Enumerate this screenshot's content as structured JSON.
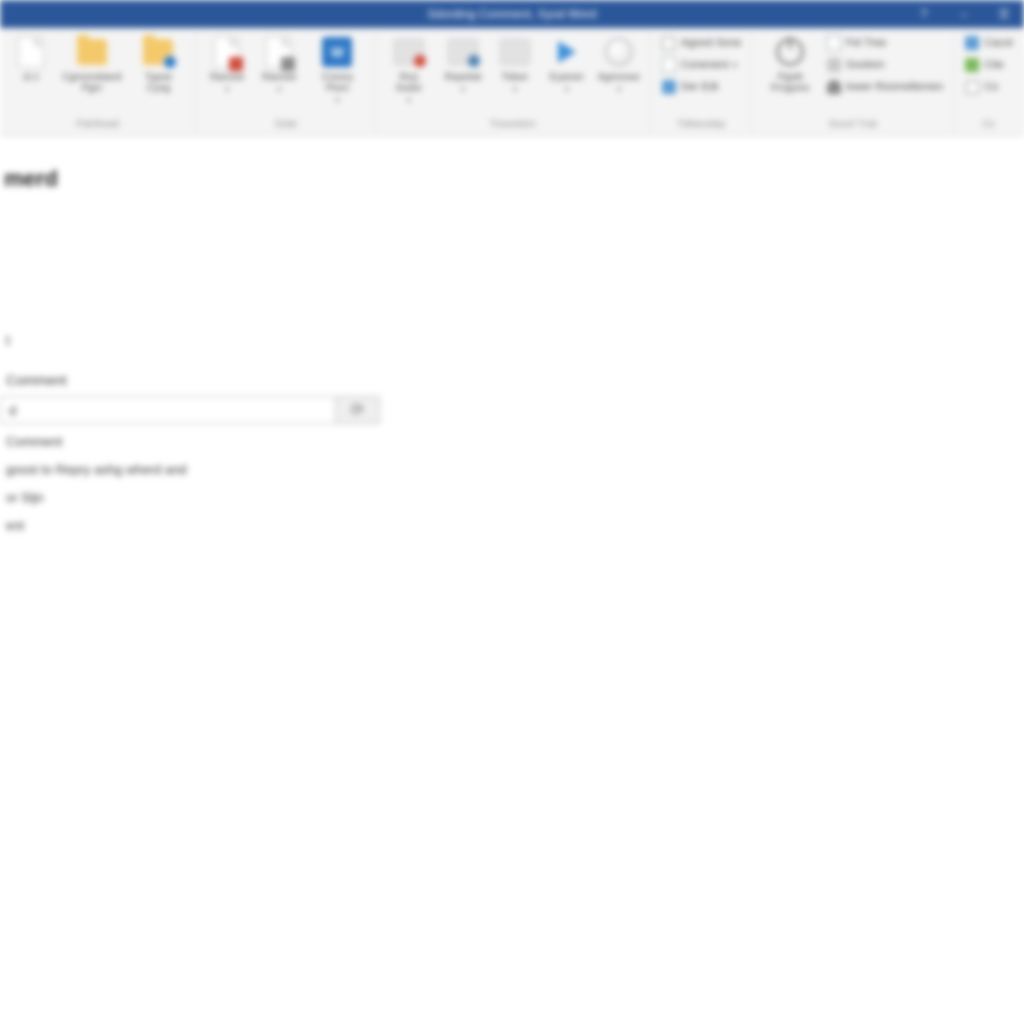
{
  "titlebar": {
    "title": "Sdording Comment, Xyod Word",
    "help": "?",
    "minimize": "–",
    "menu": "☰"
  },
  "ribbon": {
    "groups": [
      {
        "label": "Pairthead",
        "buttons": [
          {
            "label": "st\n n",
            "icon": "page"
          },
          {
            "label": "Cgmonsband\nPgm",
            "icon": "folder"
          },
          {
            "label": "Typoe\nCyog",
            "icon": "folder-badge"
          }
        ]
      },
      {
        "label": "Sslat",
        "buttons": [
          {
            "label": "Ranose",
            "icon": "page-red",
            "drop": true
          },
          {
            "label": "Ranose",
            "icon": "page-gray",
            "drop": true
          },
          {
            "label": "Cresny\nPtom",
            "icon": "blue-sq",
            "drop": true
          }
        ]
      },
      {
        "label": "Travestion",
        "buttons": [
          {
            "label": "Rorj Sodor",
            "icon": "gray-red",
            "drop": true
          },
          {
            "label": "Repetial",
            "icon": "gray-dot",
            "drop": true
          },
          {
            "label": "Tidser",
            "icon": "gray-box",
            "drop": true
          },
          {
            "label": "Eyamer",
            "icon": "play",
            "drop": true
          },
          {
            "label": "Agmoose",
            "icon": "globe",
            "drop": true
          }
        ]
      },
      {
        "label": "Tditansday",
        "small": [
          {
            "label": "Agood Sone",
            "icon": "check"
          },
          {
            "label": "Conenent",
            "icon": "tiny-doc",
            "drop": true
          },
          {
            "label": "Der Edt",
            "icon": "tiny-blue"
          }
        ]
      },
      {
        "label": "Soont Tvat",
        "buttons": [
          {
            "label": "Pgstit\nProgrere",
            "icon": "power"
          }
        ],
        "small": [
          {
            "label": "Fel Tree",
            "icon": "tiny-doc"
          },
          {
            "label": "Goolom",
            "icon": "tiny-gray"
          },
          {
            "label": "lower Roomellemen",
            "icon": "tiny-person"
          }
        ]
      },
      {
        "label": "Co",
        "small": [
          {
            "label": "Cacot",
            "icon": "tiny-blue"
          },
          {
            "label": "Ctie",
            "icon": "tiny-green"
          },
          {
            "label": "Co",
            "icon": "check"
          }
        ]
      }
    ]
  },
  "document": {
    "heading": "merd",
    "line1": "t",
    "line2": "Comment",
    "combo_value": "d",
    "after1": "Comment",
    "after2": "goost to Repry ashg wherd and",
    "after3": "or Stjn",
    "after4": "ent"
  }
}
